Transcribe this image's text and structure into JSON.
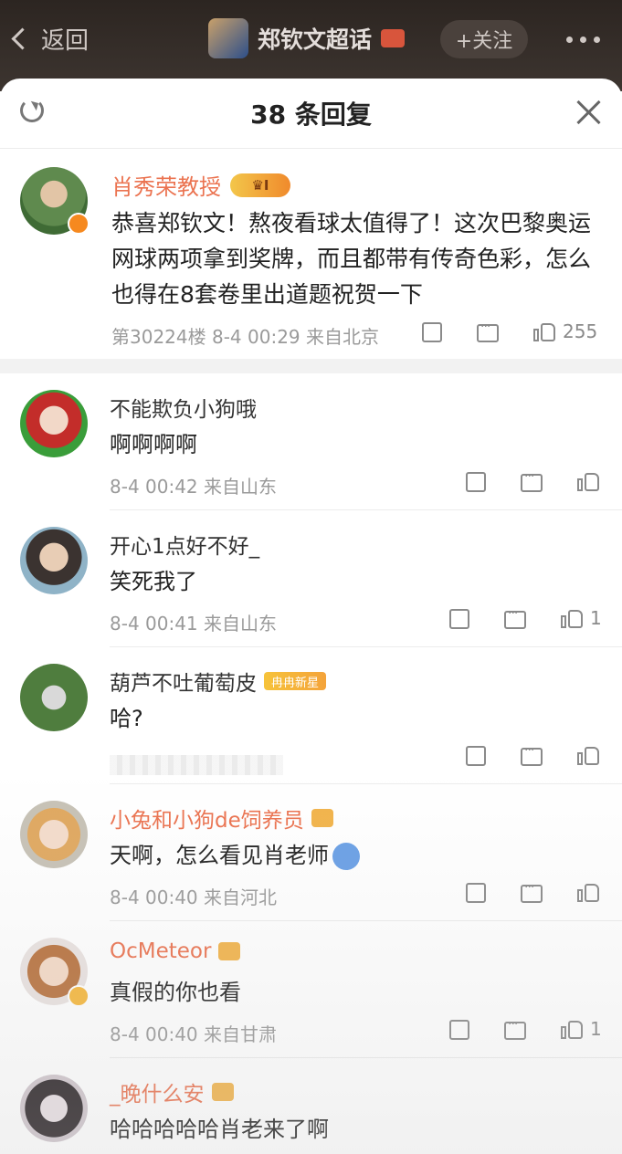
{
  "header": {
    "back_label": "返回",
    "title": "郑钦文超话",
    "follow_label": "+关注"
  },
  "sheet": {
    "title": "38 条回复"
  },
  "main_comment": {
    "user": "肖秀荣教授",
    "level": "I",
    "text": "恭喜郑钦文！熬夜看球太值得了！这次巴黎奥运网球两项拿到奖牌，而且都带有传奇色彩，怎么也得在8套卷里出道题祝贺一下",
    "meta": "第30224楼 8-4 00:29 来自北京",
    "likes": "255"
  },
  "replies": [
    {
      "user": "不能欺负小狗哦",
      "text": "啊啊啊啊",
      "meta": "8-4 00:42 来自山东",
      "likes": ""
    },
    {
      "user": "开心1点好不好_",
      "text": "笑死我了",
      "meta": "8-4 00:41 来自山东",
      "likes": "1"
    },
    {
      "user": "葫芦不吐葡萄皮",
      "tag": "冉冉新星",
      "text": "哈?",
      "meta": "",
      "likes": ""
    },
    {
      "user": "小兔和小狗de饲养员",
      "text": "天啊，怎么看见肖老师",
      "meta": "8-4 00:40 来自河北",
      "likes": ""
    },
    {
      "user": "OcMeteor",
      "text": "真假的你也看",
      "meta": "8-4 00:40 来自甘肃",
      "likes": "1"
    },
    {
      "user": "_晚什么安",
      "text": "哈哈哈哈哈肖老来了啊",
      "meta": "",
      "likes": ""
    }
  ],
  "icons": [
    "back-chevron-icon",
    "refresh-icon",
    "close-icon",
    "share-icon",
    "comment-icon",
    "like-icon",
    "more-icon"
  ],
  "colors": {
    "accent": "#eb7350",
    "topbar": "#2c2521",
    "meta": "#9a9a9a"
  }
}
